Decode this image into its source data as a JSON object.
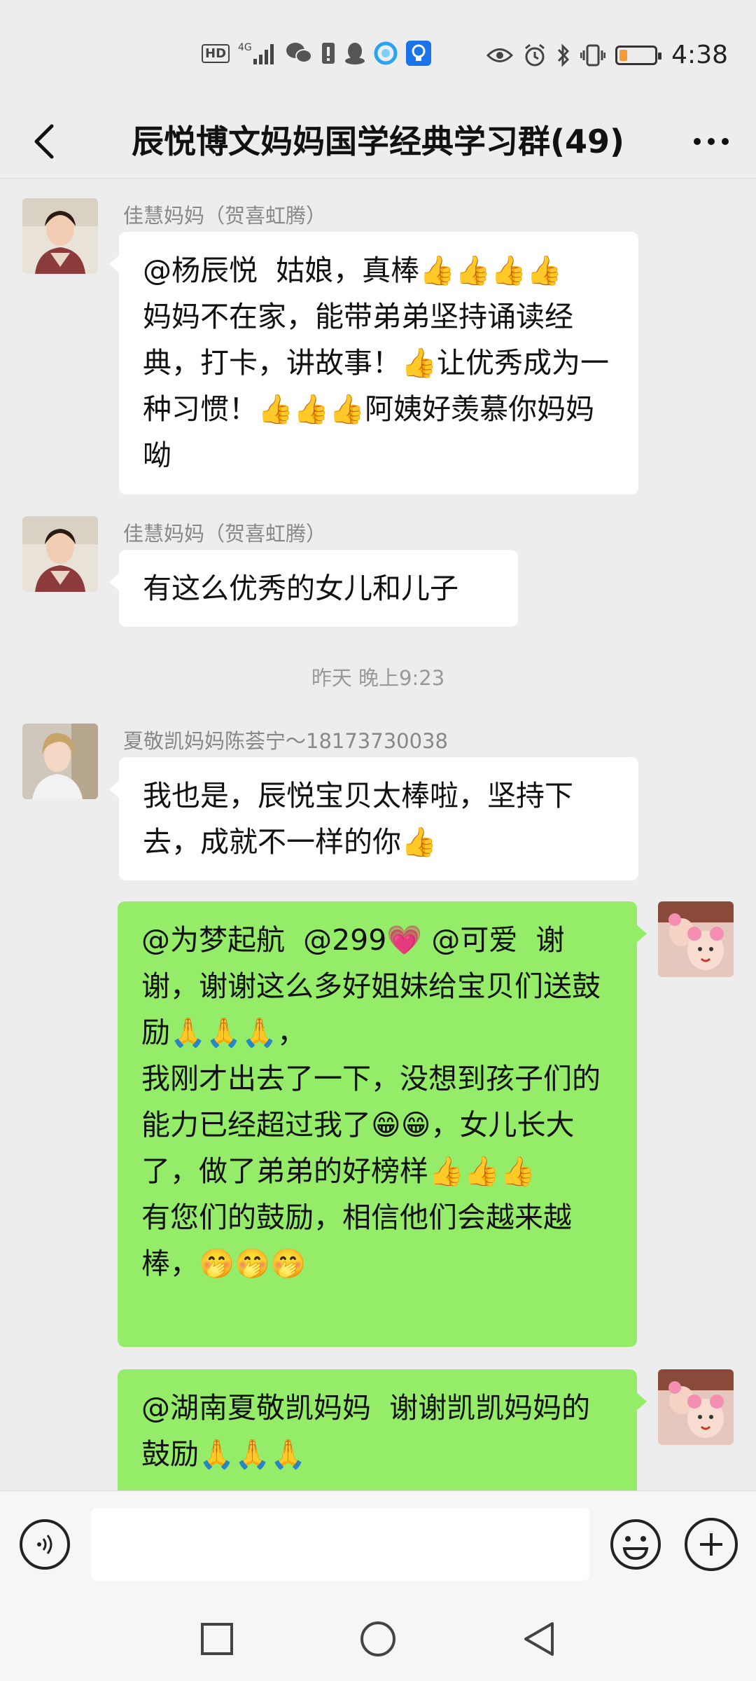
{
  "status_bar": {
    "time": "4:38",
    "network_badge": "HD",
    "signal_label": "4G",
    "battery_level": 0.22,
    "battery_color": "#f29b38"
  },
  "header": {
    "title": "辰悦博文妈妈国学经典学习群(49)",
    "back_icon": "chevron-left-icon",
    "more_icon": "more-dots-icon"
  },
  "messages": [
    {
      "sender": "佳慧妈妈（贺喜虹腾）",
      "side": "left",
      "text": "@杨辰悦  姑娘，真棒👍👍👍👍\n妈妈不在家，能带弟弟坚持诵读经典，打卡，讲故事！👍让优秀成为一种习惯！👍👍👍阿姨好羡慕你妈妈呦"
    },
    {
      "sender": "佳慧妈妈（贺喜虹腾）",
      "side": "left",
      "text": "有这么优秀的女儿和儿子"
    },
    {
      "sender": "夏敬凯妈妈陈荟宁～18173730038",
      "side": "left",
      "text": "我也是，辰悦宝贝太棒啦，坚持下去，成就不一样的你👍"
    },
    {
      "sender": "",
      "side": "right",
      "text": "@为梦起航  @299💗 @可爱  谢谢，谢谢这么多好姐妹给宝贝们送鼓励🙏🙏🙏，\n我刚才出去了一下，没想到孩子们的能力已经超过我了😁😁，女儿长大了，做了弟弟的好榜样👍👍👍\n有您们的鼓励，相信他们会越来越棒，🤭🤭🤭"
    },
    {
      "sender": "",
      "side": "right",
      "text": "@湖南夏敬凯妈妈  谢谢凯凯妈妈的鼓励🙏🙏🙏"
    }
  ],
  "timestamp": "昨天 晚上9:23",
  "input": {
    "placeholder": "",
    "value": ""
  },
  "colors": {
    "background": "#ededed",
    "bubble_self": "#95ec69",
    "bubble_other": "#ffffff"
  }
}
